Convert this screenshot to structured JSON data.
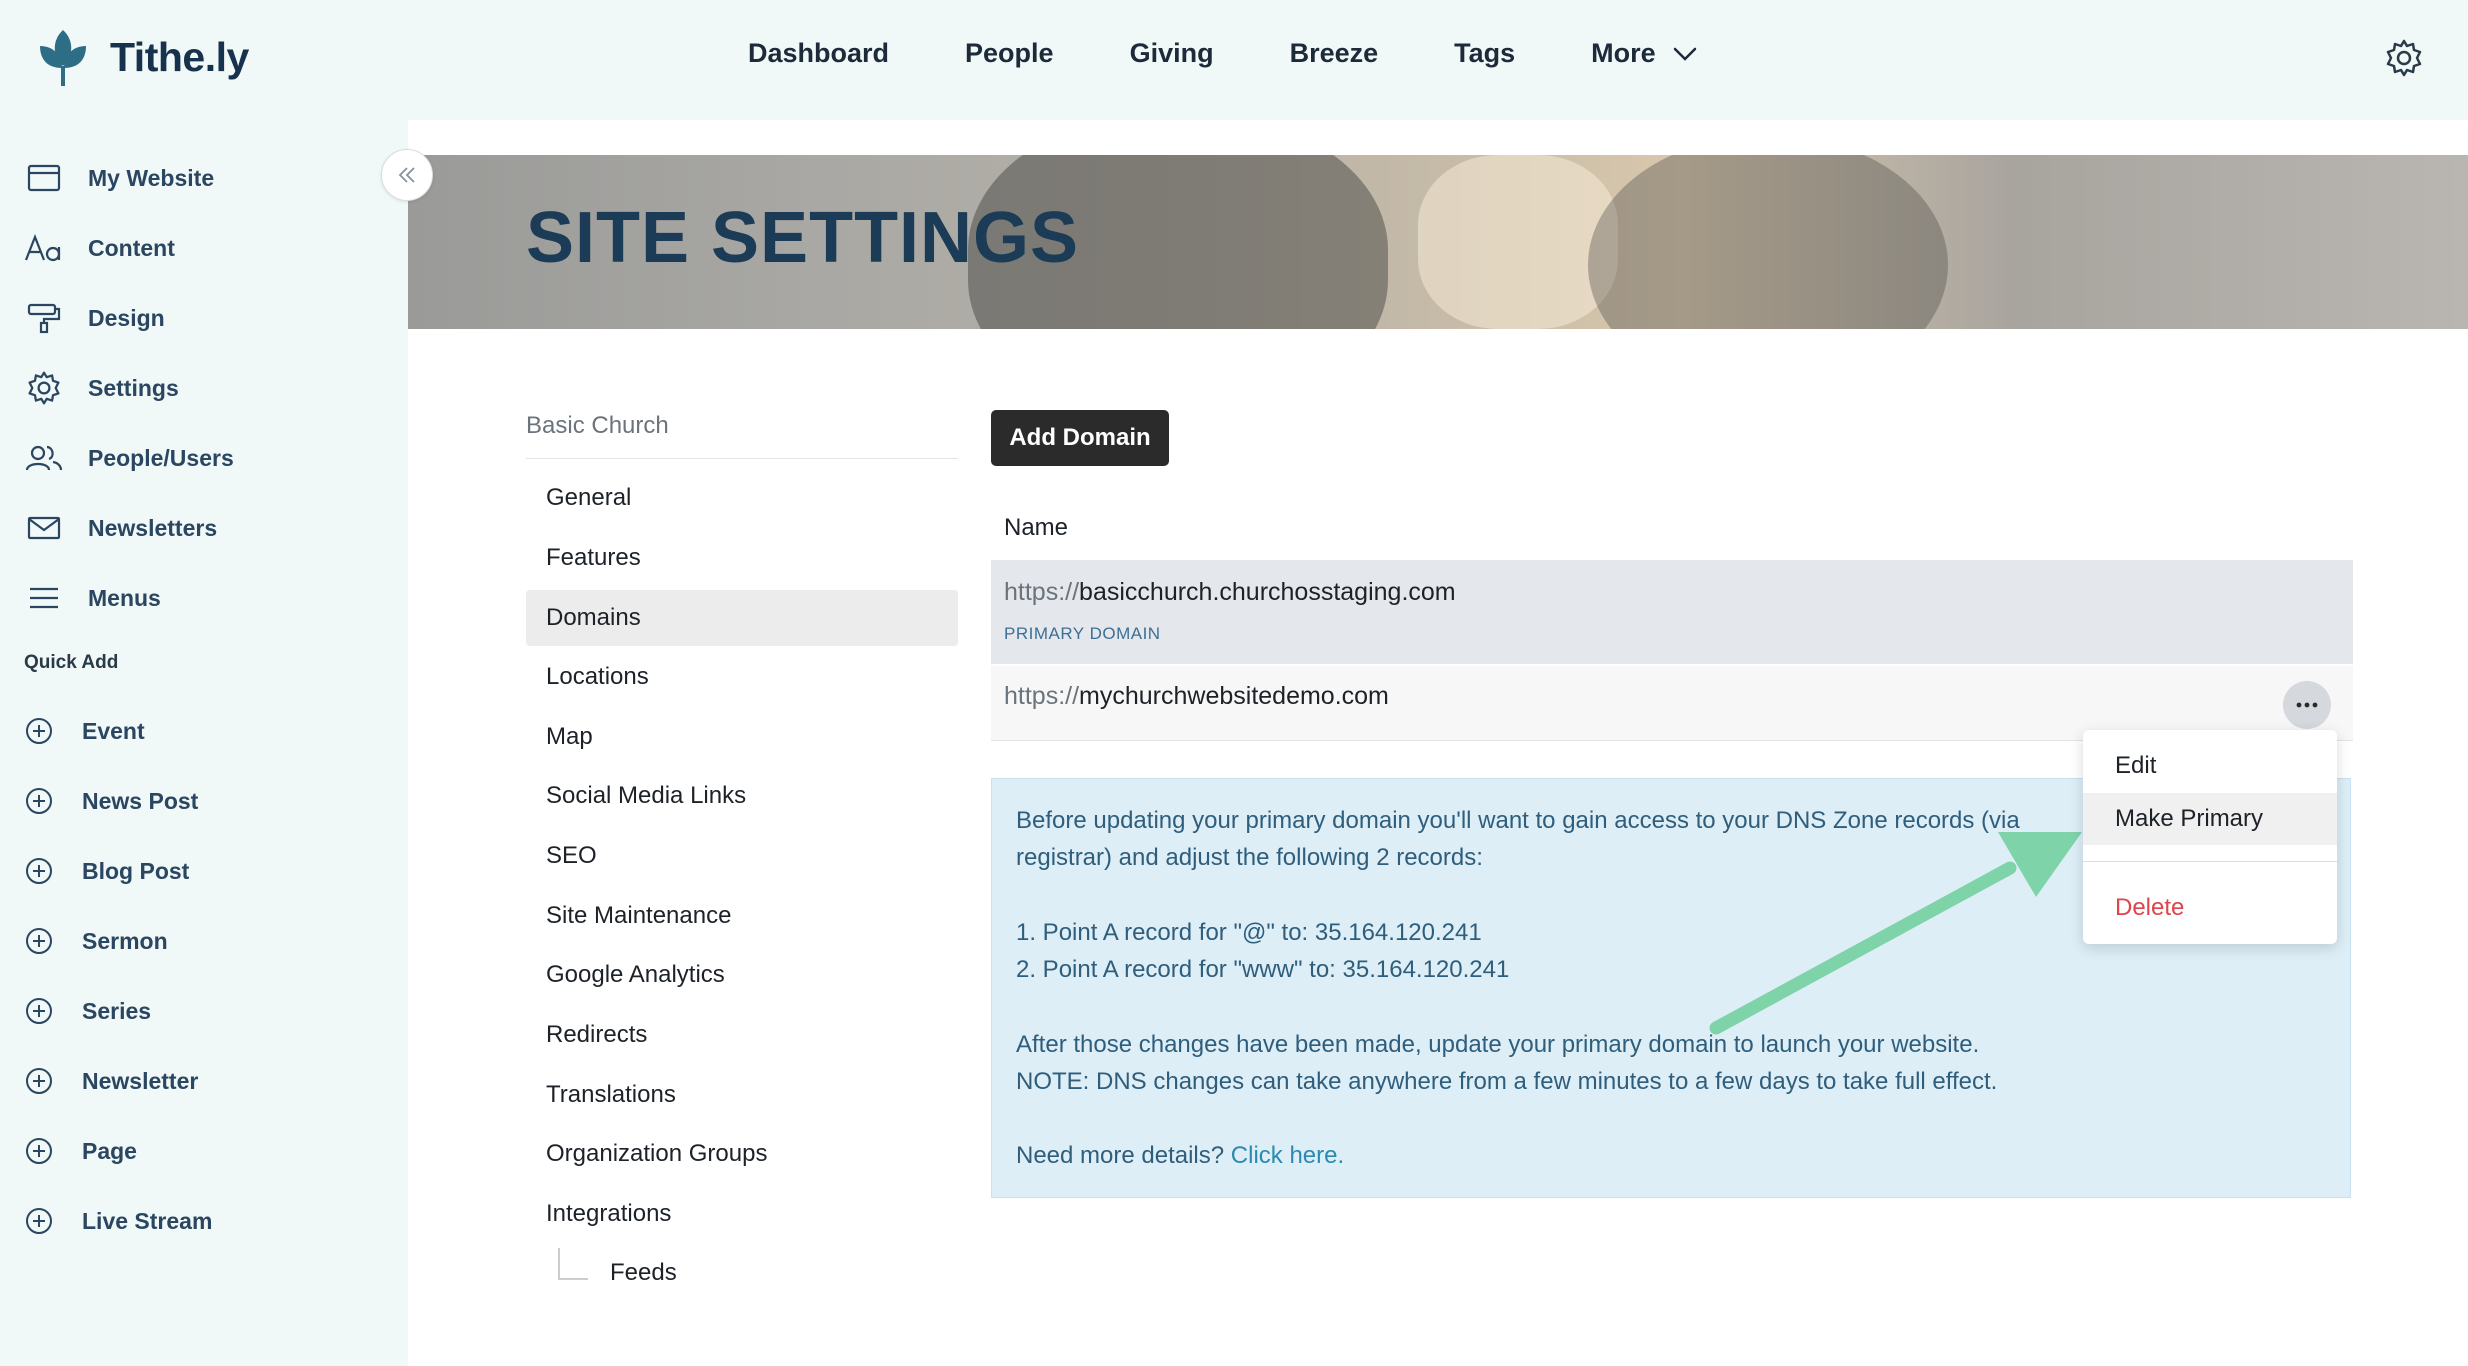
{
  "app": {
    "logo_text": "Tithe.ly"
  },
  "topnav": [
    {
      "label": "Dashboard"
    },
    {
      "label": "People"
    },
    {
      "label": "Giving"
    },
    {
      "label": "Breeze"
    },
    {
      "label": "Tags"
    },
    {
      "label": "More"
    }
  ],
  "sidebar": {
    "items": [
      {
        "label": "My Website",
        "icon": "browser-window-icon"
      },
      {
        "label": "Content",
        "icon": "text-aa-icon"
      },
      {
        "label": "Design",
        "icon": "paint-roller-icon"
      },
      {
        "label": "Settings",
        "icon": "gear-icon"
      },
      {
        "label": "People/Users",
        "icon": "users-icon"
      },
      {
        "label": "Newsletters",
        "icon": "envelope-icon"
      },
      {
        "label": "Menus",
        "icon": "hamburger-icon"
      }
    ],
    "quick_add_label": "Quick Add",
    "quick_add": [
      {
        "label": "Event"
      },
      {
        "label": "News Post"
      },
      {
        "label": "Blog Post"
      },
      {
        "label": "Sermon"
      },
      {
        "label": "Series"
      },
      {
        "label": "Newsletter"
      },
      {
        "label": "Page"
      },
      {
        "label": "Live Stream"
      }
    ]
  },
  "hero": {
    "title": "SITE SETTINGS"
  },
  "settings_nav": {
    "header": "Basic Church",
    "items": [
      {
        "label": "General"
      },
      {
        "label": "Features"
      },
      {
        "label": "Domains",
        "active": true
      },
      {
        "label": "Locations"
      },
      {
        "label": "Map"
      },
      {
        "label": "Social Media Links"
      },
      {
        "label": "SEO"
      },
      {
        "label": "Site Maintenance"
      },
      {
        "label": "Google Analytics"
      },
      {
        "label": "Redirects"
      },
      {
        "label": "Translations"
      },
      {
        "label": "Organization Groups"
      },
      {
        "label": "Integrations"
      },
      {
        "label": "Feeds"
      }
    ]
  },
  "domains": {
    "add_button": "Add Domain",
    "column_name": "Name",
    "rows": [
      {
        "prefix": "https://",
        "host": "basicchurch.churchosstaging.com",
        "badge": "PRIMARY DOMAIN"
      },
      {
        "prefix": "https://",
        "host": "mychurchwebsitedemo.com"
      }
    ]
  },
  "info": {
    "line1": "Before updating your primary domain you'll want to gain access to your DNS Zone records (via",
    "line2": "registrar) and adjust the following 2 records:",
    "line3": "1. Point A record for \"@\" to: 35.164.120.241",
    "line4": "2. Point A record for \"www\" to: 35.164.120.241",
    "line5": "After those changes have been made, update your primary domain to launch your website.",
    "line6": "NOTE: DNS changes can take anywhere from a few minutes to a few days to take full effect.",
    "line7": "Need more details?",
    "link": "Click here."
  },
  "menu": {
    "edit": "Edit",
    "make_primary": "Make Primary",
    "delete": "Delete"
  },
  "colors": {
    "sidebar_bg": "#f1f8f8",
    "arrow": "#7fd3a8",
    "delete": "#e0444a",
    "info_bg": "#ddeef7"
  }
}
